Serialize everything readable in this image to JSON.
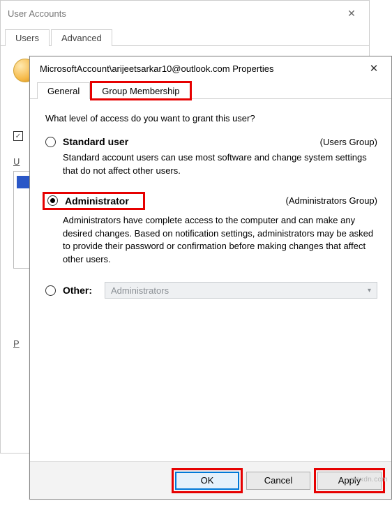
{
  "parent": {
    "title": "User Accounts",
    "close": "✕",
    "tabs": {
      "users": "Users",
      "advanced": "Advanced"
    },
    "checkbox_checked": "✓",
    "underline_letter": "U",
    "p_label": "P"
  },
  "dialog": {
    "title": "MicrosoftAccount\\arijeetsarkar10@outlook.com Properties",
    "close": "✕",
    "tabs": {
      "general": "General",
      "group": "Group Membership"
    },
    "question": "What level of access do you want to grant this user?",
    "standard": {
      "label": "Standard user",
      "group": "(Users Group)",
      "desc": "Standard account users can use most software and change system settings that do not affect other users."
    },
    "admin": {
      "label": "Administrator",
      "group": "(Administrators Group)",
      "desc": "Administrators have complete access to the computer and can make any desired changes. Based on notification settings, administrators may be asked to provide their password or confirmation before making changes that affect other users."
    },
    "other": {
      "label": "Other:",
      "dropdown_value": "Administrators"
    },
    "buttons": {
      "ok": "OK",
      "cancel": "Cancel",
      "apply": "Apply"
    }
  },
  "watermark": "wsxdn.com"
}
